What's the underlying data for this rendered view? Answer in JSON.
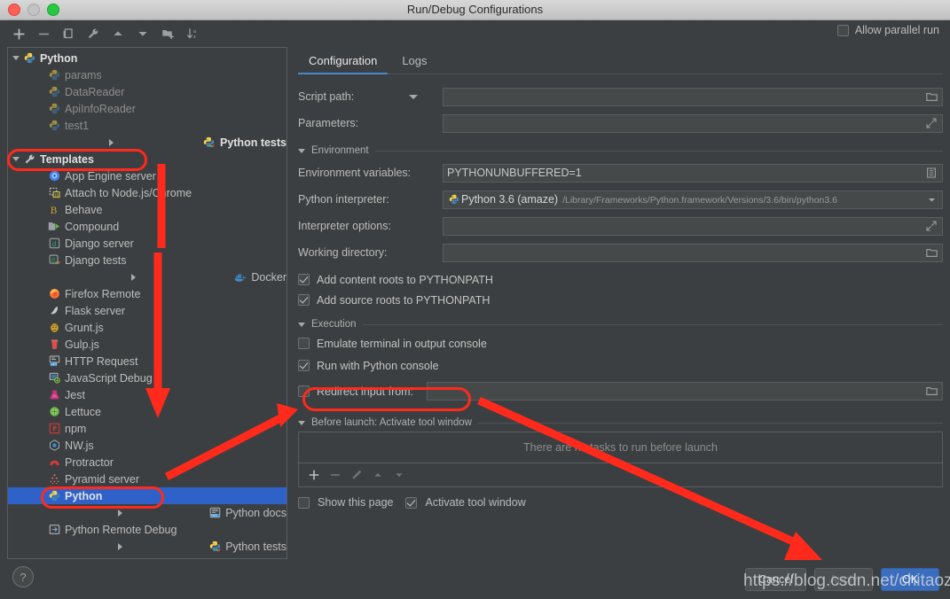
{
  "window": {
    "title": "Run/Debug Configurations",
    "traffic_lights": [
      "close-button",
      "minimize-button",
      "zoom-button"
    ]
  },
  "toolbar": {
    "icons": [
      {
        "name": "add-icon",
        "label": "+"
      },
      {
        "name": "remove-icon",
        "label": "−"
      },
      {
        "name": "copy-icon",
        "label": "Copy"
      },
      {
        "name": "edit-templates-icon",
        "label": "Edit Templates"
      },
      {
        "name": "move-up-icon",
        "label": "Move Up"
      },
      {
        "name": "move-down-icon",
        "label": "Move Down"
      },
      {
        "name": "new-folder-icon",
        "label": "New Folder"
      },
      {
        "name": "sort-alphabetically-icon",
        "label": "Sort"
      }
    ],
    "allow_parallel_run": {
      "label": "Allow parallel run",
      "checked": false
    }
  },
  "tree": [
    {
      "label": "Python",
      "indent": 0,
      "arrow": "down",
      "icon": "python-icon",
      "bold": true,
      "dim": false,
      "selected": false
    },
    {
      "label": "params",
      "indent": 2,
      "arrow": "none",
      "icon": "python-file-icon",
      "bold": false,
      "dim": true,
      "selected": false
    },
    {
      "label": "DataReader",
      "indent": 2,
      "arrow": "none",
      "icon": "python-file-icon",
      "bold": false,
      "dim": true,
      "selected": false
    },
    {
      "label": "ApiInfoReader",
      "indent": 2,
      "arrow": "none",
      "icon": "python-file-icon",
      "bold": false,
      "dim": true,
      "selected": false
    },
    {
      "label": "test1",
      "indent": 2,
      "arrow": "none",
      "icon": "python-file-icon",
      "bold": false,
      "dim": true,
      "selected": false
    },
    {
      "label": "Python tests",
      "indent": 0,
      "arrow": "right",
      "icon": "python-tests-icon",
      "bold": true,
      "dim": false,
      "selected": false
    },
    {
      "label": "Templates",
      "indent": 0,
      "arrow": "down",
      "icon": "wrench-icon",
      "bold": true,
      "dim": false,
      "selected": false
    },
    {
      "label": "App Engine server",
      "indent": 2,
      "arrow": "none",
      "icon": "app-engine-icon",
      "bold": false,
      "dim": false,
      "selected": false
    },
    {
      "label": "Attach to Node.js/Chrome",
      "indent": 2,
      "arrow": "none",
      "icon": "nodejs-attach-icon",
      "bold": false,
      "dim": false,
      "selected": false
    },
    {
      "label": "Behave",
      "indent": 2,
      "arrow": "none",
      "icon": "behave-icon",
      "bold": false,
      "dim": false,
      "selected": false
    },
    {
      "label": "Compound",
      "indent": 2,
      "arrow": "none",
      "icon": "compound-icon",
      "bold": false,
      "dim": false,
      "selected": false
    },
    {
      "label": "Django server",
      "indent": 2,
      "arrow": "none",
      "icon": "django-server-icon",
      "bold": false,
      "dim": false,
      "selected": false
    },
    {
      "label": "Django tests",
      "indent": 2,
      "arrow": "none",
      "icon": "django-tests-icon",
      "bold": false,
      "dim": false,
      "selected": false
    },
    {
      "label": "Docker",
      "indent": 1,
      "arrow": "right",
      "icon": "docker-icon",
      "bold": false,
      "dim": false,
      "selected": false
    },
    {
      "label": "Firefox Remote",
      "indent": 2,
      "arrow": "none",
      "icon": "firefox-icon",
      "bold": false,
      "dim": false,
      "selected": false
    },
    {
      "label": "Flask server",
      "indent": 2,
      "arrow": "none",
      "icon": "flask-icon",
      "bold": false,
      "dim": false,
      "selected": false
    },
    {
      "label": "Grunt.js",
      "indent": 2,
      "arrow": "none",
      "icon": "grunt-icon",
      "bold": false,
      "dim": false,
      "selected": false
    },
    {
      "label": "Gulp.js",
      "indent": 2,
      "arrow": "none",
      "icon": "gulp-icon",
      "bold": false,
      "dim": false,
      "selected": false
    },
    {
      "label": "HTTP Request",
      "indent": 2,
      "arrow": "none",
      "icon": "http-request-icon",
      "bold": false,
      "dim": false,
      "selected": false
    },
    {
      "label": "JavaScript Debug",
      "indent": 2,
      "arrow": "none",
      "icon": "javascript-debug-icon",
      "bold": false,
      "dim": false,
      "selected": false
    },
    {
      "label": "Jest",
      "indent": 2,
      "arrow": "none",
      "icon": "jest-icon",
      "bold": false,
      "dim": false,
      "selected": false
    },
    {
      "label": "Lettuce",
      "indent": 2,
      "arrow": "none",
      "icon": "lettuce-icon",
      "bold": false,
      "dim": false,
      "selected": false
    },
    {
      "label": "npm",
      "indent": 2,
      "arrow": "none",
      "icon": "npm-icon",
      "bold": false,
      "dim": false,
      "selected": false
    },
    {
      "label": "NW.js",
      "indent": 2,
      "arrow": "none",
      "icon": "nwjs-icon",
      "bold": false,
      "dim": false,
      "selected": false
    },
    {
      "label": "Protractor",
      "indent": 2,
      "arrow": "none",
      "icon": "protractor-icon",
      "bold": false,
      "dim": false,
      "selected": false
    },
    {
      "label": "Pyramid server",
      "indent": 2,
      "arrow": "none",
      "icon": "pyramid-icon",
      "bold": false,
      "dim": false,
      "selected": false
    },
    {
      "label": "Python",
      "indent": 2,
      "arrow": "none",
      "icon": "python-icon",
      "bold": true,
      "dim": false,
      "selected": true
    },
    {
      "label": "Python docs",
      "indent": 1,
      "arrow": "right",
      "icon": "python-docs-icon",
      "bold": false,
      "dim": false,
      "selected": false
    },
    {
      "label": "Python Remote Debug",
      "indent": 2,
      "arrow": "none",
      "icon": "python-remote-debug-icon",
      "bold": false,
      "dim": false,
      "selected": false
    },
    {
      "label": "Python tests",
      "indent": 1,
      "arrow": "right",
      "icon": "python-tests-icon",
      "bold": false,
      "dim": false,
      "selected": false
    }
  ],
  "tabs": [
    {
      "label": "Configuration",
      "active": true
    },
    {
      "label": "Logs",
      "active": false
    }
  ],
  "form": {
    "script_path": {
      "label": "Script path:",
      "value": "",
      "end_icon": "folder-icon"
    },
    "parameters": {
      "label": "Parameters:",
      "value": "",
      "end_icon": "expand-icon"
    },
    "environment_section": "Environment",
    "environment_variables": {
      "label": "Environment variables:",
      "value": "PYTHONUNBUFFERED=1",
      "end_icon": "list-icon"
    },
    "python_interpreter": {
      "label": "Python interpreter:",
      "name": "Python 3.6 (amaze)",
      "path": "/Library/Frameworks/Python.framework/Versions/3.6/bin/python3.6",
      "end_icon": "chevron-down-icon"
    },
    "interpreter_options": {
      "label": "Interpreter options:",
      "value": "",
      "end_icon": "expand-icon"
    },
    "working_directory": {
      "label": "Working directory:",
      "value": "",
      "end_icon": "folder-icon"
    },
    "add_content_roots": {
      "label": "Add content roots to PYTHONPATH",
      "checked": true
    },
    "add_source_roots": {
      "label": "Add source roots to PYTHONPATH",
      "checked": true
    },
    "execution_section": "Execution",
    "emulate_terminal": {
      "label": "Emulate terminal in output console",
      "checked": false
    },
    "run_with_python_console": {
      "label": "Run with Python console",
      "checked": true
    },
    "redirect_input": {
      "label": "Redirect input from:",
      "checked": false,
      "value": "",
      "end_icon": "folder-icon"
    },
    "before_launch_section": "Before launch: Activate tool window",
    "no_tasks_text": "There are no tasks to run before launch",
    "tasks_toolbar": [
      {
        "name": "add-task-icon",
        "label": "+"
      },
      {
        "name": "remove-task-icon",
        "label": "−"
      },
      {
        "name": "edit-task-icon",
        "label": "Edit"
      },
      {
        "name": "move-task-up-icon",
        "label": "Up"
      },
      {
        "name": "move-task-down-icon",
        "label": "Down"
      }
    ],
    "show_this_page": {
      "label": "Show this page",
      "checked": false
    },
    "activate_tool_window": {
      "label": "Activate tool window",
      "checked": true
    }
  },
  "footer": {
    "help_label": "?",
    "cancel": "Cancel",
    "apply": "Apply",
    "ok": "OK"
  },
  "annotations": {
    "watermark": "https://blog.csdn.net/chitaozi",
    "highlight_color": "#ff2a1c",
    "highlighted": [
      "Templates",
      "Python",
      "Run with Python console"
    ]
  },
  "colors": {
    "accent_blue": "#3b6dbf",
    "selection_blue": "#2f62c8",
    "panel_bg": "#3c3f41",
    "field_bg": "#45494a",
    "annotation_red": "#ff2a1c"
  }
}
